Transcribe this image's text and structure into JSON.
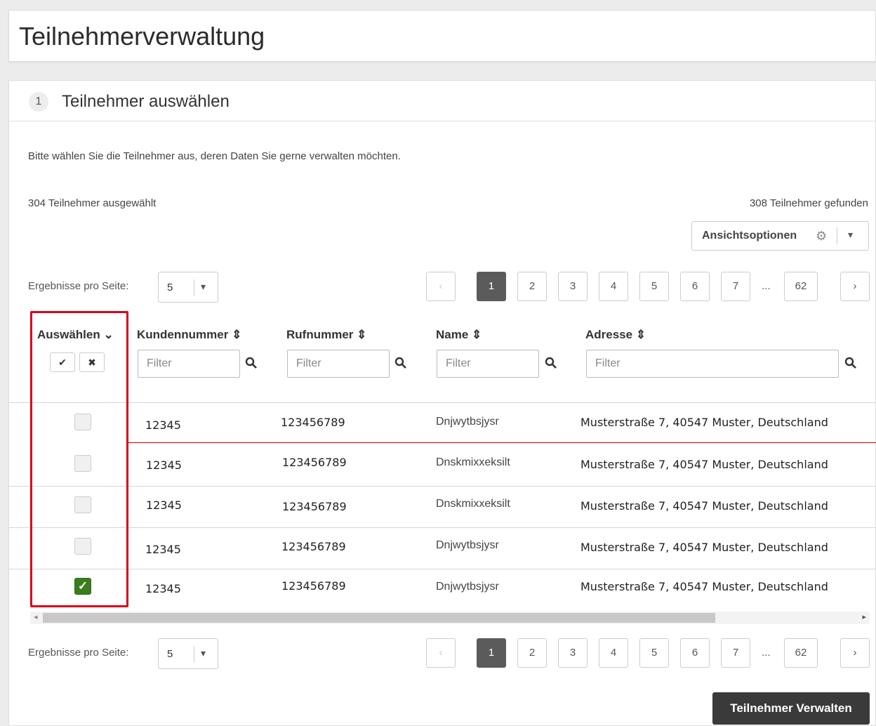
{
  "page": {
    "title": "Teilnehmerverwaltung"
  },
  "step": {
    "number": "1",
    "title": "Teilnehmer auswählen"
  },
  "intro": "Bitte wählen Sie die Teilnehmer aus, deren Daten Sie gerne verwalten möchten.",
  "counts": {
    "selected": "304 Teilnehmer ausgewählt",
    "found": "308 Teilnehmer gefunden"
  },
  "view_options": {
    "label": "Ansichtsoptionen",
    "gear_icon": "gear-icon",
    "caret_icon": "chevron-down-icon"
  },
  "per_page": {
    "label": "Ergebnisse pro Seite:",
    "value": "5"
  },
  "pagination": {
    "prev": "‹",
    "next": "›",
    "pages": [
      "1",
      "2",
      "3",
      "4",
      "5",
      "6",
      "7"
    ],
    "ellipsis": "...",
    "last": "62",
    "current": "1"
  },
  "table": {
    "select_header": "Auswählen",
    "select_all_label": "✔",
    "deselect_all_label": "✖",
    "columns": [
      {
        "label": "Kundennummer",
        "filter_placeholder": "Filter"
      },
      {
        "label": "Rufnummer",
        "filter_placeholder": "Filter"
      },
      {
        "label": "Name",
        "filter_placeholder": "Filter"
      },
      {
        "label": "Adresse",
        "filter_placeholder": "Filter"
      }
    ],
    "rows": [
      {
        "checked": false,
        "kundennummer": "12345",
        "rufnummer": "123456789",
        "name": "Dnjwytbsjysr",
        "adresse": "Musterstraße 7, 40547 Muster, Deutschland"
      },
      {
        "checked": false,
        "kundennummer": "12345",
        "rufnummer": "123456789",
        "name": "Dnskmixxeksilt",
        "adresse": "Musterstraße 7, 40547 Muster, Deutschland"
      },
      {
        "checked": false,
        "kundennummer": "12345",
        "rufnummer": "123456789",
        "name": "Dnskmixxeksilt",
        "adresse": "Musterstraße 7, 40547 Muster, Deutschland"
      },
      {
        "checked": false,
        "kundennummer": "12345",
        "rufnummer": "123456789",
        "name": "Dnjwytbsjysr",
        "adresse": "Musterstraße 7, 40547 Muster, Deutschland"
      },
      {
        "checked": true,
        "kundennummer": "12345",
        "rufnummer": "123456789",
        "name": "Dnjwytbsjysr",
        "adresse": "Musterstraße 7, 40547 Muster, Deutschland"
      }
    ]
  },
  "colors": {
    "highlight": "#d9001b",
    "checked": "#3b7d1c",
    "active_page": "#5b5b5b",
    "primary_button": "#3a3a3a"
  },
  "primary_button": {
    "label": "Teilnehmer Verwalten"
  }
}
